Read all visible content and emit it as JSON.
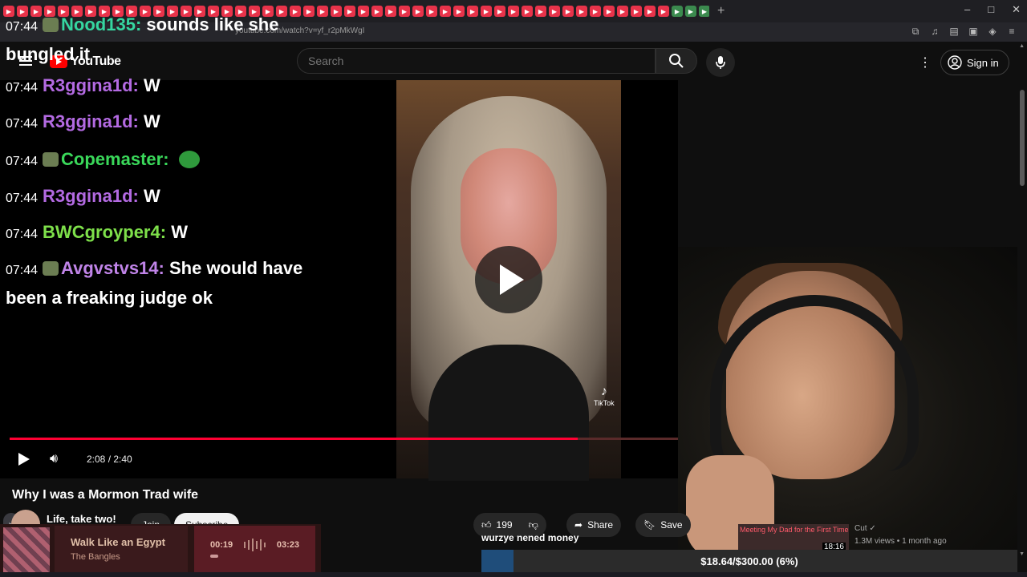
{
  "browser": {
    "url": "youtube.com/watch?v=yf_r2pMkWgI",
    "close_tab": "×",
    "new_tab": "+",
    "window_controls": [
      "–",
      "□",
      "✕"
    ]
  },
  "youtube": {
    "logo_text": "YouTube",
    "search_placeholder": "Search",
    "sign_in": "Sign in"
  },
  "player": {
    "current_time": "2:08",
    "duration": "2:40",
    "time_display": "2:08 / 2:40",
    "progress_fraction": 0.8,
    "watermark": "TikTok"
  },
  "chat": [
    {
      "time": "07:44",
      "user": "Nood135:",
      "text": "sounds like she bungled it",
      "color": "#35d6a0",
      "badge": true
    },
    {
      "time": "07:44",
      "user": "R3ggina1d:",
      "text": "W",
      "color": "#b36ae2",
      "badge": false
    },
    {
      "time": "07:44",
      "user": "R3ggina1d:",
      "text": "W",
      "color": "#b36ae2",
      "badge": false
    },
    {
      "time": "07:44",
      "user": "Copemaster:",
      "text": "",
      "color": "#3ad85a",
      "badge": true,
      "emote": true
    },
    {
      "time": "07:44",
      "user": "R3ggina1d:",
      "text": "W",
      "color": "#b36ae2",
      "badge": false
    },
    {
      "time": "07:44",
      "user": "BWCgroyper4:",
      "text": "W",
      "color": "#7ee04a",
      "badge": false
    },
    {
      "time": "07:44",
      "user": "Avgvstvs14:",
      "text": "She would have been a freaking judge ok",
      "color": "#c084e8",
      "badge": true
    }
  ],
  "video": {
    "title": "Why I was a Mormon Trad wife",
    "channel": "Life, take two!",
    "join": "Join",
    "subscribe": "Subscribe",
    "likes": "199",
    "share": "Share",
    "save": "Save"
  },
  "recommended": {
    "thumb_title": "Meeting My Dad for the First Time",
    "duration": "18:16",
    "channel": "Cut",
    "views": "1.3M views",
    "age": "1 month ago",
    "meta": "1.3M views • 1 month ago"
  },
  "overlay": {
    "caption": "wurzye nened money",
    "donation": "$18.64/$300.00 (6%)",
    "donation_fraction": 0.06
  },
  "music": {
    "title": "Walk Like an Egypt",
    "artist": "The Bangles",
    "elapsed": "00:19",
    "total": "03:23"
  },
  "colors": {
    "accent_red": "#ff0033",
    "donation_blue": "#1f4d7a"
  }
}
